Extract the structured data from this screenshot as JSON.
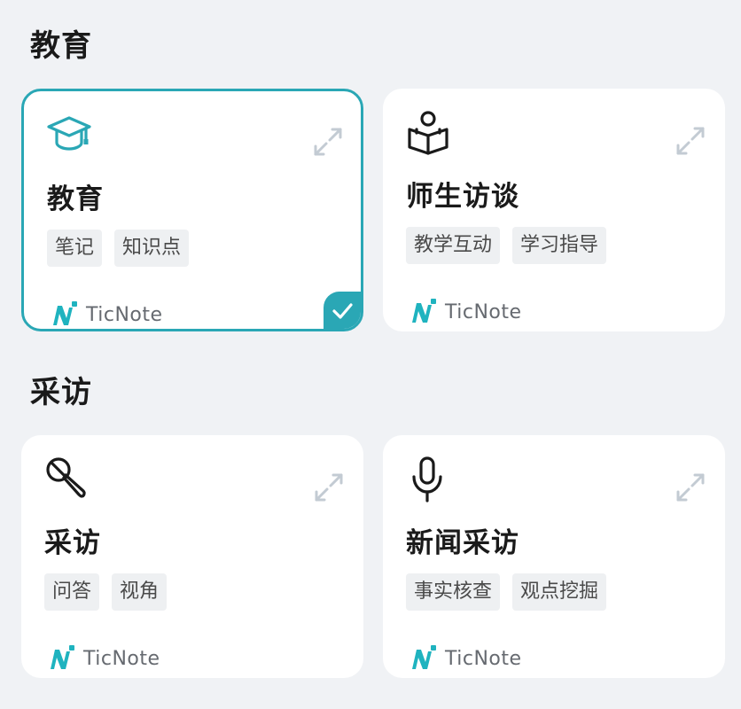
{
  "sections": [
    {
      "title": "教育",
      "cards": [
        {
          "icon": "graduation-cap-icon",
          "title": "教育",
          "tags": [
            "笔记",
            "知识点"
          ],
          "brand": "TicNote",
          "selected": true
        },
        {
          "icon": "person-reading-icon",
          "title": "师生访谈",
          "tags": [
            "教学互动",
            "学习指导"
          ],
          "brand": "TicNote",
          "selected": false
        }
      ]
    },
    {
      "title": "采访",
      "cards": [
        {
          "icon": "handheld-mic-icon",
          "title": "采访",
          "tags": [
            "问答",
            "视角"
          ],
          "brand": "TicNote",
          "selected": false
        },
        {
          "icon": "microphone-icon",
          "title": "新闻采访",
          "tags": [
            "事实核查",
            "观点挖掘"
          ],
          "brand": "TicNote",
          "selected": false
        }
      ]
    }
  ],
  "colors": {
    "accent": "#2aa7b5",
    "background": "#f0f2f5",
    "card": "#ffffff",
    "tag_bg": "#eef0f2",
    "expand_icon": "#c3cbd3"
  }
}
